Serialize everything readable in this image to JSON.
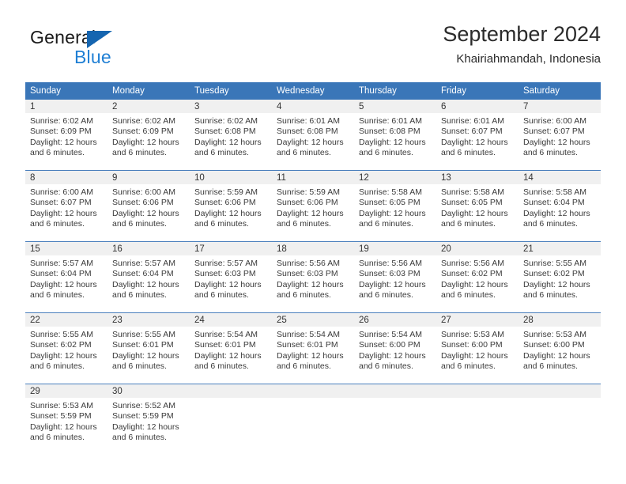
{
  "brand": {
    "name_part1": "General",
    "name_part2": "Blue",
    "triangle_color": "#1565b0",
    "blue_color": "#1f7fd4"
  },
  "header": {
    "month_title": "September 2024",
    "location": "Khairiahmandah, Indonesia"
  },
  "theme": {
    "header_blue": "#3a76b8",
    "day_band_gray": "#f0f0f0",
    "separator": "#4a7fbd",
    "text": "#3a3a3a"
  },
  "weekdays": [
    "Sunday",
    "Monday",
    "Tuesday",
    "Wednesday",
    "Thursday",
    "Friday",
    "Saturday"
  ],
  "labels": {
    "sunrise_prefix": "Sunrise: ",
    "sunset_prefix": "Sunset: ",
    "daylight_prefix": "Daylight: "
  },
  "weeks": [
    {
      "days": [
        {
          "number": "1",
          "sunrise": "Sunrise: 6:02 AM",
          "sunset": "Sunset: 6:09 PM",
          "daylight": "Daylight: 12 hours and 6 minutes."
        },
        {
          "number": "2",
          "sunrise": "Sunrise: 6:02 AM",
          "sunset": "Sunset: 6:09 PM",
          "daylight": "Daylight: 12 hours and 6 minutes."
        },
        {
          "number": "3",
          "sunrise": "Sunrise: 6:02 AM",
          "sunset": "Sunset: 6:08 PM",
          "daylight": "Daylight: 12 hours and 6 minutes."
        },
        {
          "number": "4",
          "sunrise": "Sunrise: 6:01 AM",
          "sunset": "Sunset: 6:08 PM",
          "daylight": "Daylight: 12 hours and 6 minutes."
        },
        {
          "number": "5",
          "sunrise": "Sunrise: 6:01 AM",
          "sunset": "Sunset: 6:08 PM",
          "daylight": "Daylight: 12 hours and 6 minutes."
        },
        {
          "number": "6",
          "sunrise": "Sunrise: 6:01 AM",
          "sunset": "Sunset: 6:07 PM",
          "daylight": "Daylight: 12 hours and 6 minutes."
        },
        {
          "number": "7",
          "sunrise": "Sunrise: 6:00 AM",
          "sunset": "Sunset: 6:07 PM",
          "daylight": "Daylight: 12 hours and 6 minutes."
        }
      ]
    },
    {
      "days": [
        {
          "number": "8",
          "sunrise": "Sunrise: 6:00 AM",
          "sunset": "Sunset: 6:07 PM",
          "daylight": "Daylight: 12 hours and 6 minutes."
        },
        {
          "number": "9",
          "sunrise": "Sunrise: 6:00 AM",
          "sunset": "Sunset: 6:06 PM",
          "daylight": "Daylight: 12 hours and 6 minutes."
        },
        {
          "number": "10",
          "sunrise": "Sunrise: 5:59 AM",
          "sunset": "Sunset: 6:06 PM",
          "daylight": "Daylight: 12 hours and 6 minutes."
        },
        {
          "number": "11",
          "sunrise": "Sunrise: 5:59 AM",
          "sunset": "Sunset: 6:06 PM",
          "daylight": "Daylight: 12 hours and 6 minutes."
        },
        {
          "number": "12",
          "sunrise": "Sunrise: 5:58 AM",
          "sunset": "Sunset: 6:05 PM",
          "daylight": "Daylight: 12 hours and 6 minutes."
        },
        {
          "number": "13",
          "sunrise": "Sunrise: 5:58 AM",
          "sunset": "Sunset: 6:05 PM",
          "daylight": "Daylight: 12 hours and 6 minutes."
        },
        {
          "number": "14",
          "sunrise": "Sunrise: 5:58 AM",
          "sunset": "Sunset: 6:04 PM",
          "daylight": "Daylight: 12 hours and 6 minutes."
        }
      ]
    },
    {
      "days": [
        {
          "number": "15",
          "sunrise": "Sunrise: 5:57 AM",
          "sunset": "Sunset: 6:04 PM",
          "daylight": "Daylight: 12 hours and 6 minutes."
        },
        {
          "number": "16",
          "sunrise": "Sunrise: 5:57 AM",
          "sunset": "Sunset: 6:04 PM",
          "daylight": "Daylight: 12 hours and 6 minutes."
        },
        {
          "number": "17",
          "sunrise": "Sunrise: 5:57 AM",
          "sunset": "Sunset: 6:03 PM",
          "daylight": "Daylight: 12 hours and 6 minutes."
        },
        {
          "number": "18",
          "sunrise": "Sunrise: 5:56 AM",
          "sunset": "Sunset: 6:03 PM",
          "daylight": "Daylight: 12 hours and 6 minutes."
        },
        {
          "number": "19",
          "sunrise": "Sunrise: 5:56 AM",
          "sunset": "Sunset: 6:03 PM",
          "daylight": "Daylight: 12 hours and 6 minutes."
        },
        {
          "number": "20",
          "sunrise": "Sunrise: 5:56 AM",
          "sunset": "Sunset: 6:02 PM",
          "daylight": "Daylight: 12 hours and 6 minutes."
        },
        {
          "number": "21",
          "sunrise": "Sunrise: 5:55 AM",
          "sunset": "Sunset: 6:02 PM",
          "daylight": "Daylight: 12 hours and 6 minutes."
        }
      ]
    },
    {
      "days": [
        {
          "number": "22",
          "sunrise": "Sunrise: 5:55 AM",
          "sunset": "Sunset: 6:02 PM",
          "daylight": "Daylight: 12 hours and 6 minutes."
        },
        {
          "number": "23",
          "sunrise": "Sunrise: 5:55 AM",
          "sunset": "Sunset: 6:01 PM",
          "daylight": "Daylight: 12 hours and 6 minutes."
        },
        {
          "number": "24",
          "sunrise": "Sunrise: 5:54 AM",
          "sunset": "Sunset: 6:01 PM",
          "daylight": "Daylight: 12 hours and 6 minutes."
        },
        {
          "number": "25",
          "sunrise": "Sunrise: 5:54 AM",
          "sunset": "Sunset: 6:01 PM",
          "daylight": "Daylight: 12 hours and 6 minutes."
        },
        {
          "number": "26",
          "sunrise": "Sunrise: 5:54 AM",
          "sunset": "Sunset: 6:00 PM",
          "daylight": "Daylight: 12 hours and 6 minutes."
        },
        {
          "number": "27",
          "sunrise": "Sunrise: 5:53 AM",
          "sunset": "Sunset: 6:00 PM",
          "daylight": "Daylight: 12 hours and 6 minutes."
        },
        {
          "number": "28",
          "sunrise": "Sunrise: 5:53 AM",
          "sunset": "Sunset: 6:00 PM",
          "daylight": "Daylight: 12 hours and 6 minutes."
        }
      ]
    },
    {
      "days": [
        {
          "number": "29",
          "sunrise": "Sunrise: 5:53 AM",
          "sunset": "Sunset: 5:59 PM",
          "daylight": "Daylight: 12 hours and 6 minutes."
        },
        {
          "number": "30",
          "sunrise": "Sunrise: 5:52 AM",
          "sunset": "Sunset: 5:59 PM",
          "daylight": "Daylight: 12 hours and 6 minutes."
        },
        {
          "number": "",
          "sunrise": "",
          "sunset": "",
          "daylight": ""
        },
        {
          "number": "",
          "sunrise": "",
          "sunset": "",
          "daylight": ""
        },
        {
          "number": "",
          "sunrise": "",
          "sunset": "",
          "daylight": ""
        },
        {
          "number": "",
          "sunrise": "",
          "sunset": "",
          "daylight": ""
        },
        {
          "number": "",
          "sunrise": "",
          "sunset": "",
          "daylight": ""
        }
      ]
    }
  ]
}
